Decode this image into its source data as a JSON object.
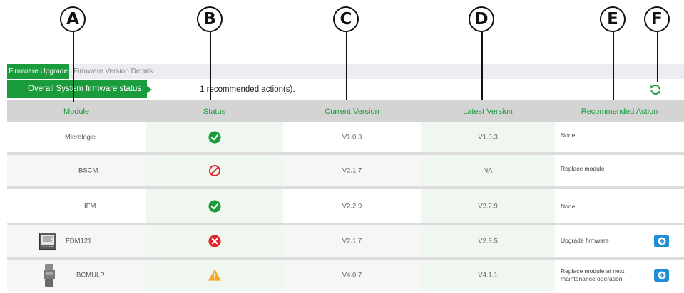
{
  "callouts": [
    "A",
    "B",
    "C",
    "D",
    "E",
    "F"
  ],
  "tabs": {
    "active": "Firmware Upgrade",
    "inactive": "Firmware Version Details"
  },
  "status": {
    "banner": "Overall System firmware status",
    "summary": "1 recommended action(s)."
  },
  "header": {
    "module": "Module",
    "status": "Status",
    "current": "Current Version",
    "latest": "Latest Version",
    "action": "Recommended Action"
  },
  "rows": [
    {
      "module": "Micrologic",
      "status": "ok",
      "current": "V1.0.3",
      "latest": "V1.0.3",
      "action": "None"
    },
    {
      "module": "BSCM",
      "status": "not-allowed",
      "current": "V2.1.7",
      "latest": "NA",
      "action": "Replace module"
    },
    {
      "module": "IFM",
      "status": "ok",
      "current": "V2.2.9",
      "latest": "V2.2.9",
      "action": "None"
    },
    {
      "module": "FDM121",
      "status": "error",
      "current": "V2.1.7",
      "latest": "V2.3.5",
      "action": "Upgrade firmware"
    },
    {
      "module": "BCMULP",
      "status": "warning",
      "current": "V4.0.7",
      "latest": "V4.1.1",
      "action": "Replace module at next maintenance operation"
    }
  ],
  "colors": {
    "brand_green": "#1a9b3c",
    "ok": "#1a9b3c",
    "error": "#e0262b",
    "warning": "#f5a623",
    "upload": "#1e8fd6"
  }
}
